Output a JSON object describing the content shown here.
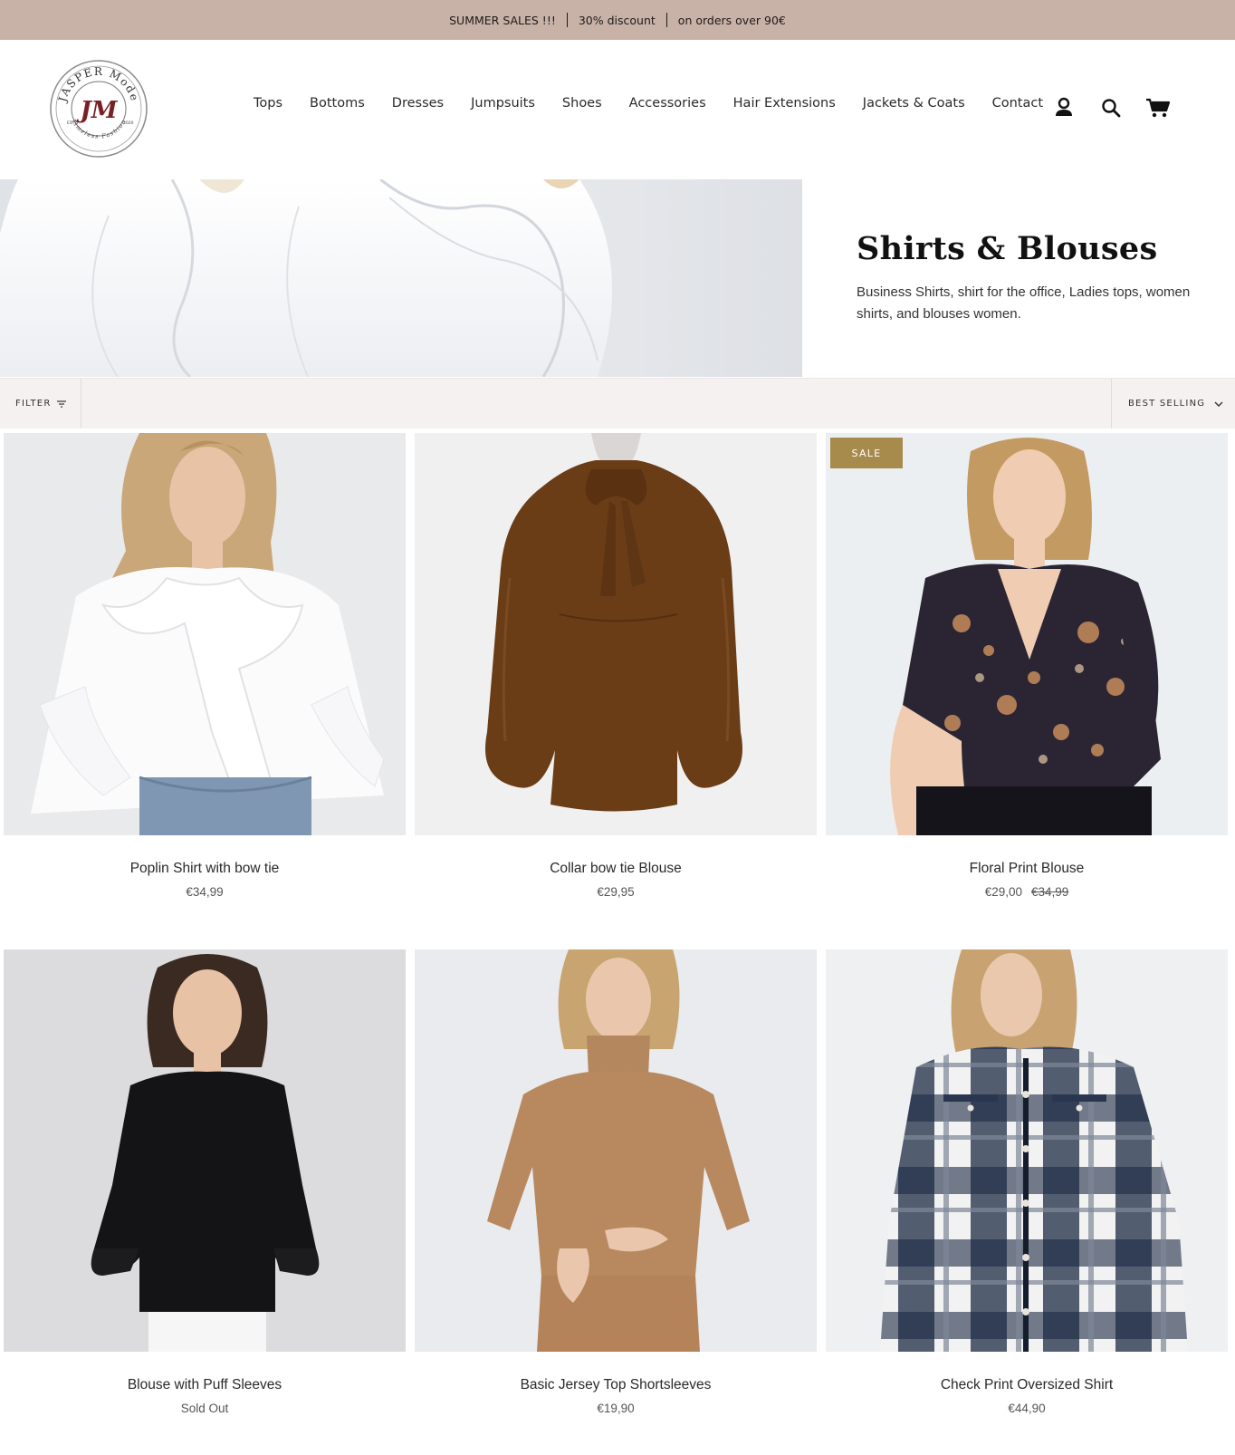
{
  "announcement": {
    "items": [
      "SUMMER SALES !!!",
      "30% discount",
      "on orders over 90€"
    ]
  },
  "header": {
    "logo": {
      "top_text": "JASPER Mode",
      "monogram": "JM",
      "left_text": "ESTD",
      "right_text": "2020",
      "bottom_text": "Timeless Fashion"
    },
    "nav": [
      "Tops",
      "Bottoms",
      "Dresses",
      "Jumpsuits",
      "Shoes",
      "Accessories",
      "Hair Extensions",
      "Jackets & Coats",
      "Contact"
    ],
    "icons": [
      "account-icon",
      "search-icon",
      "cart-icon"
    ]
  },
  "hero": {
    "title": "Shirts & Blouses",
    "description": "Business Shirts, shirt for the office, Ladies tops, women shirts, and blouses women."
  },
  "toolbar": {
    "filter_label": "FILTER",
    "sort_label": "BEST SELLING"
  },
  "products": [
    {
      "name": "Poplin Shirt with bow tie",
      "price": "€34,99",
      "was": "",
      "badge": ""
    },
    {
      "name": "Collar bow tie Blouse",
      "price": "€29,95",
      "was": "",
      "badge": ""
    },
    {
      "name": "Floral Print Blouse",
      "price": "€29,00",
      "was": "€34,99",
      "badge": "SALE"
    },
    {
      "name": "Blouse with Puff Sleeves",
      "price": "Sold Out",
      "was": "",
      "badge": ""
    },
    {
      "name": "Basic Jersey Top Shortsleeves",
      "price": "€19,90",
      "was": "",
      "badge": ""
    },
    {
      "name": "Check Print Oversized Shirt",
      "price": "€44,90",
      "was": "",
      "badge": ""
    }
  ],
  "colors": {
    "announcement_bg": "#c8b2a8",
    "toolbar_bg": "#f5f1f0",
    "sale_badge": "#a78b4c",
    "logo_accent": "#7a1f24"
  }
}
